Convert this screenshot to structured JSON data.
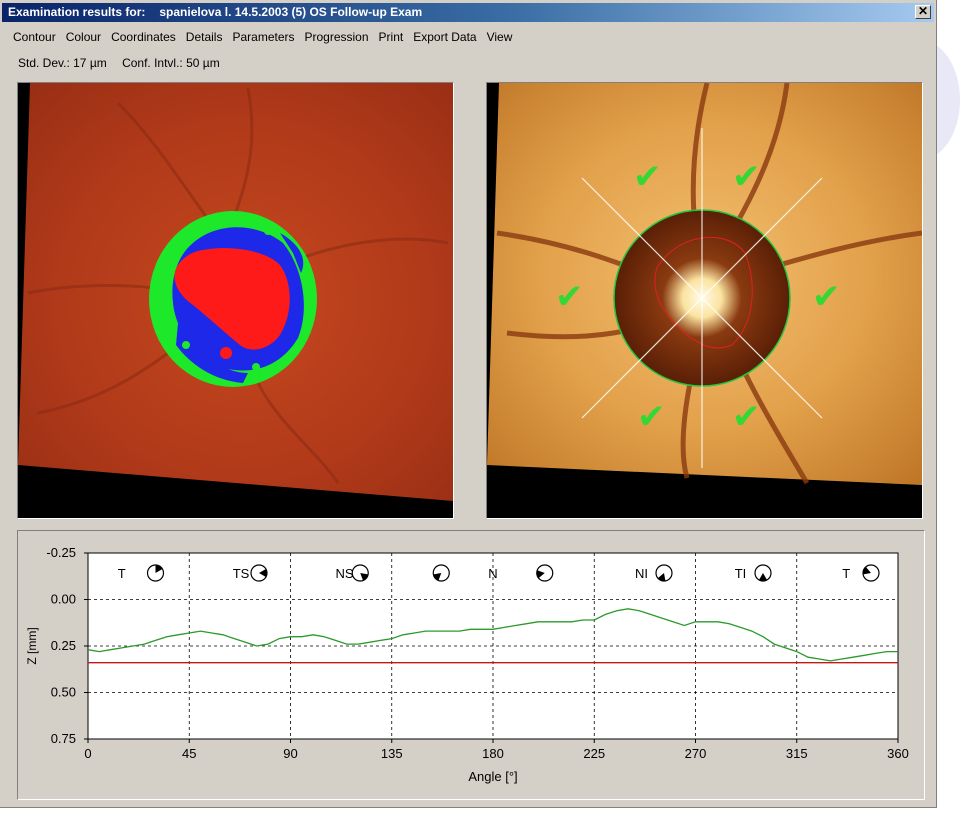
{
  "window": {
    "title_prefix": "Examination results for:",
    "title_details": "spanielova l.   14.5.2003   (5)   OS   Follow-up Exam",
    "close_glyph": "✕"
  },
  "menu": [
    "Contour",
    "Colour",
    "Coordinates",
    "Details",
    "Parameters",
    "Progression",
    "Print",
    "Export Data",
    "View"
  ],
  "status": {
    "std_dev": "Std. Dev.: 17 µm",
    "conf_intvl": "Conf. Intvl.: 50 µm"
  },
  "colors": {
    "window_bg": "#d4d0c8",
    "title_start": "#0a246a",
    "fundus_left_bg": "#b83c1c",
    "topo_green": "#1ee82a",
    "topo_blue": "#1e28e8",
    "topo_red": "#ff1a1a",
    "reflectance_bg": "#e7a24a",
    "check_green": "#34d834",
    "series_green": "#2b9a2b",
    "reference_red": "#c01818"
  },
  "images": {
    "left": "topography-map",
    "right": "reflectance-image"
  },
  "chart_data": {
    "type": "line",
    "title": "",
    "xlabel": "Angle [°]",
    "ylabel": "Z [mm]",
    "xlim": [
      0,
      360
    ],
    "ylim": [
      -0.25,
      0.75
    ],
    "y_inverted": true,
    "x_ticks": [
      0,
      45,
      90,
      135,
      180,
      225,
      270,
      315,
      360
    ],
    "y_ticks": [
      "-0.25",
      "0.00",
      "0.25",
      "0.50",
      "0.75"
    ],
    "grid": "dashed at x = 45, 90, 135, 180, 225, 270, 315 and y = 0.00, 0.25, 0.50",
    "sectors": [
      {
        "label": "T",
        "x": 15
      },
      {
        "label": "TS",
        "x": 68
      },
      {
        "label": "NS",
        "x": 114
      },
      {
        "label": "N",
        "x": 180
      },
      {
        "label": "NI",
        "x": 246
      },
      {
        "label": "TI",
        "x": 290
      },
      {
        "label": "T",
        "x": 337
      }
    ],
    "sector_icons": [
      {
        "x": 30,
        "wedge": [
          0,
          60
        ]
      },
      {
        "x": 76,
        "wedge": [
          60,
          120
        ]
      },
      {
        "x": 121,
        "wedge": [
          100,
          160
        ]
      },
      {
        "x": 157,
        "wedge": [
          200,
          260
        ]
      },
      {
        "x": 203,
        "wedge": [
          230,
          290
        ]
      },
      {
        "x": 256,
        "wedge": [
          170,
          230
        ]
      },
      {
        "x": 300,
        "wedge": [
          150,
          210
        ]
      },
      {
        "x": 348,
        "wedge": [
          260,
          320
        ]
      }
    ],
    "series": [
      {
        "color": "#2b9a2b",
        "x": [
          0,
          5,
          10,
          15,
          20,
          25,
          30,
          35,
          40,
          45,
          50,
          55,
          60,
          65,
          70,
          75,
          80,
          85,
          90,
          95,
          100,
          105,
          110,
          115,
          120,
          125,
          130,
          135,
          140,
          145,
          150,
          155,
          160,
          165,
          170,
          175,
          180,
          185,
          190,
          195,
          200,
          205,
          210,
          215,
          220,
          225,
          230,
          235,
          240,
          245,
          250,
          255,
          260,
          265,
          270,
          275,
          280,
          285,
          290,
          295,
          300,
          305,
          310,
          315,
          320,
          325,
          330,
          335,
          340,
          345,
          350,
          355,
          360
        ],
        "values": [
          0.27,
          0.28,
          0.27,
          0.26,
          0.25,
          0.24,
          0.22,
          0.2,
          0.19,
          0.18,
          0.17,
          0.18,
          0.19,
          0.21,
          0.23,
          0.25,
          0.24,
          0.21,
          0.2,
          0.2,
          0.19,
          0.2,
          0.22,
          0.24,
          0.24,
          0.23,
          0.22,
          0.21,
          0.19,
          0.18,
          0.17,
          0.17,
          0.17,
          0.17,
          0.16,
          0.16,
          0.16,
          0.15,
          0.14,
          0.13,
          0.12,
          0.12,
          0.12,
          0.12,
          0.11,
          0.11,
          0.08,
          0.06,
          0.05,
          0.06,
          0.08,
          0.1,
          0.12,
          0.14,
          0.12,
          0.12,
          0.12,
          0.13,
          0.15,
          0.17,
          0.2,
          0.24,
          0.26,
          0.28,
          0.31,
          0.32,
          0.33,
          0.32,
          0.31,
          0.3,
          0.29,
          0.28,
          0.28
        ]
      },
      {
        "color": "#c01818",
        "x": [
          0,
          360
        ],
        "values": [
          0.34,
          0.34
        ]
      }
    ]
  }
}
